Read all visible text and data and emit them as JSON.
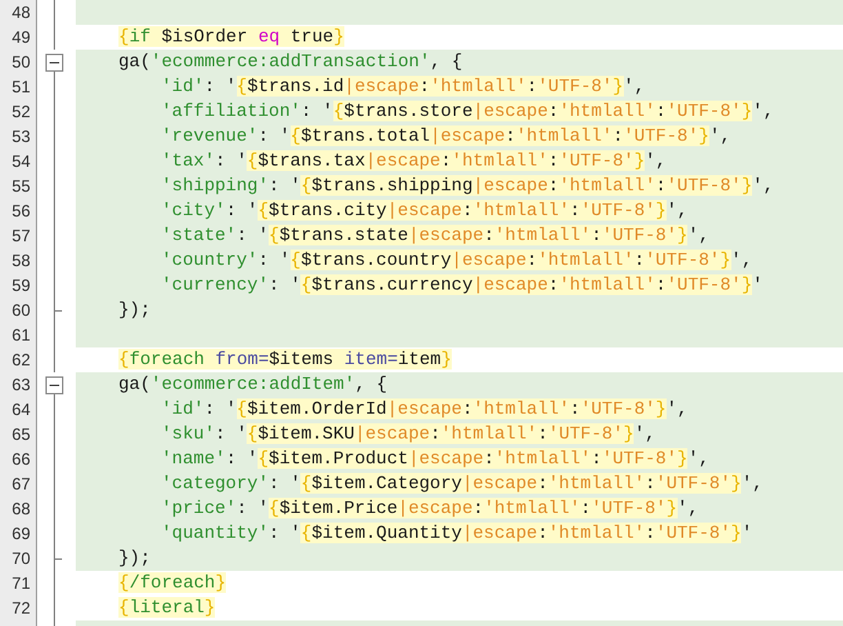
{
  "editor": {
    "lines": [
      {
        "number": "48",
        "kind": "literal"
      },
      {
        "number": "49",
        "kind": "template",
        "tokens": [
          {
            "text": "{",
            "kind": "tag-brace"
          },
          {
            "text": "if",
            "kind": "tag-keyword"
          },
          {
            "text": " $isOrder ",
            "kind": "tag-text"
          },
          {
            "text": "eq",
            "kind": "tag-operator"
          },
          {
            "text": " true",
            "kind": "tag-text"
          },
          {
            "text": "}",
            "kind": "tag-brace"
          }
        ]
      },
      {
        "number": "50",
        "kind": "literal",
        "expanded": true,
        "tokens": [
          {
            "text": "ga(",
            "kind": "code"
          },
          {
            "text": "'ecommerce:addTransaction'",
            "kind": "string"
          },
          {
            "text": ", {",
            "kind": "code"
          }
        ],
        "children": [
          {
            "number": "51",
            "kind": "literal",
            "tokens": [
              {
                "text": "'id'",
                "kind": "string"
              },
              {
                "text": ": '",
                "kind": "code"
              },
              {
                "text": "{",
                "kind": "tag-brace"
              },
              {
                "text": "$trans.id",
                "kind": "tag-text"
              },
              {
                "text": "|escape",
                "kind": "tag-modifier"
              },
              {
                "text": ":",
                "kind": "tag-text"
              },
              {
                "text": "'htmlall'",
                "kind": "tag-modifier"
              },
              {
                "text": ":",
                "kind": "tag-text"
              },
              {
                "text": "'UTF-8'",
                "kind": "tag-modifier"
              },
              {
                "text": "}",
                "kind": "tag-brace"
              },
              {
                "text": "',",
                "kind": "code"
              }
            ]
          },
          {
            "number": "52",
            "kind": "literal",
            "tokens": [
              {
                "text": "'affiliation'",
                "kind": "string"
              },
              {
                "text": ": '",
                "kind": "code"
              },
              {
                "text": "{",
                "kind": "tag-brace"
              },
              {
                "text": "$trans.store",
                "kind": "tag-text"
              },
              {
                "text": "|escape",
                "kind": "tag-modifier"
              },
              {
                "text": ":",
                "kind": "tag-text"
              },
              {
                "text": "'htmlall'",
                "kind": "tag-modifier"
              },
              {
                "text": ":",
                "kind": "tag-text"
              },
              {
                "text": "'UTF-8'",
                "kind": "tag-modifier"
              },
              {
                "text": "}",
                "kind": "tag-brace"
              },
              {
                "text": "',",
                "kind": "code"
              }
            ]
          },
          {
            "number": "53",
            "kind": "literal",
            "tokens": [
              {
                "text": "'revenue'",
                "kind": "string"
              },
              {
                "text": ": '",
                "kind": "code"
              },
              {
                "text": "{",
                "kind": "tag-brace"
              },
              {
                "text": "$trans.total",
                "kind": "tag-text"
              },
              {
                "text": "|escape",
                "kind": "tag-modifier"
              },
              {
                "text": ":",
                "kind": "tag-text"
              },
              {
                "text": "'htmlall'",
                "kind": "tag-modifier"
              },
              {
                "text": ":",
                "kind": "tag-text"
              },
              {
                "text": "'UTF-8'",
                "kind": "tag-modifier"
              },
              {
                "text": "}",
                "kind": "tag-brace"
              },
              {
                "text": "',",
                "kind": "code"
              }
            ]
          },
          {
            "number": "54",
            "kind": "literal",
            "tokens": [
              {
                "text": "'tax'",
                "kind": "string"
              },
              {
                "text": ": '",
                "kind": "code"
              },
              {
                "text": "{",
                "kind": "tag-brace"
              },
              {
                "text": "$trans.tax",
                "kind": "tag-text"
              },
              {
                "text": "|escape",
                "kind": "tag-modifier"
              },
              {
                "text": ":",
                "kind": "tag-text"
              },
              {
                "text": "'htmlall'",
                "kind": "tag-modifier"
              },
              {
                "text": ":",
                "kind": "tag-text"
              },
              {
                "text": "'UTF-8'",
                "kind": "tag-modifier"
              },
              {
                "text": "}",
                "kind": "tag-brace"
              },
              {
                "text": "',",
                "kind": "code"
              }
            ]
          },
          {
            "number": "55",
            "kind": "literal",
            "tokens": [
              {
                "text": "'shipping'",
                "kind": "string"
              },
              {
                "text": ": '",
                "kind": "code"
              },
              {
                "text": "{",
                "kind": "tag-brace"
              },
              {
                "text": "$trans.shipping",
                "kind": "tag-text"
              },
              {
                "text": "|escape",
                "kind": "tag-modifier"
              },
              {
                "text": ":",
                "kind": "tag-text"
              },
              {
                "text": "'htmlall'",
                "kind": "tag-modifier"
              },
              {
                "text": ":",
                "kind": "tag-text"
              },
              {
                "text": "'UTF-8'",
                "kind": "tag-modifier"
              },
              {
                "text": "}",
                "kind": "tag-brace"
              },
              {
                "text": "',",
                "kind": "code"
              }
            ]
          },
          {
            "number": "56",
            "kind": "literal",
            "tokens": [
              {
                "text": "'city'",
                "kind": "string"
              },
              {
                "text": ": '",
                "kind": "code"
              },
              {
                "text": "{",
                "kind": "tag-brace"
              },
              {
                "text": "$trans.city",
                "kind": "tag-text"
              },
              {
                "text": "|escape",
                "kind": "tag-modifier"
              },
              {
                "text": ":",
                "kind": "tag-text"
              },
              {
                "text": "'htmlall'",
                "kind": "tag-modifier"
              },
              {
                "text": ":",
                "kind": "tag-text"
              },
              {
                "text": "'UTF-8'",
                "kind": "tag-modifier"
              },
              {
                "text": "}",
                "kind": "tag-brace"
              },
              {
                "text": "',",
                "kind": "code"
              }
            ]
          },
          {
            "number": "57",
            "kind": "literal",
            "tokens": [
              {
                "text": "'state'",
                "kind": "string"
              },
              {
                "text": ": '",
                "kind": "code"
              },
              {
                "text": "{",
                "kind": "tag-brace"
              },
              {
                "text": "$trans.state",
                "kind": "tag-text"
              },
              {
                "text": "|escape",
                "kind": "tag-modifier"
              },
              {
                "text": ":",
                "kind": "tag-text"
              },
              {
                "text": "'htmlall'",
                "kind": "tag-modifier"
              },
              {
                "text": ":",
                "kind": "tag-text"
              },
              {
                "text": "'UTF-8'",
                "kind": "tag-modifier"
              },
              {
                "text": "}",
                "kind": "tag-brace"
              },
              {
                "text": "',",
                "kind": "code"
              }
            ]
          },
          {
            "number": "58",
            "kind": "literal",
            "tokens": [
              {
                "text": "'country'",
                "kind": "string"
              },
              {
                "text": ": '",
                "kind": "code"
              },
              {
                "text": "{",
                "kind": "tag-brace"
              },
              {
                "text": "$trans.country",
                "kind": "tag-text"
              },
              {
                "text": "|escape",
                "kind": "tag-modifier"
              },
              {
                "text": ":",
                "kind": "tag-text"
              },
              {
                "text": "'htmlall'",
                "kind": "tag-modifier"
              },
              {
                "text": ":",
                "kind": "tag-text"
              },
              {
                "text": "'UTF-8'",
                "kind": "tag-modifier"
              },
              {
                "text": "}",
                "kind": "tag-brace"
              },
              {
                "text": "',",
                "kind": "code"
              }
            ]
          },
          {
            "number": "59",
            "kind": "literal",
            "tokens": [
              {
                "text": "'currency'",
                "kind": "string"
              },
              {
                "text": ": '",
                "kind": "code"
              },
              {
                "text": "{",
                "kind": "tag-brace"
              },
              {
                "text": "$trans.currency",
                "kind": "tag-text"
              },
              {
                "text": "|escape",
                "kind": "tag-modifier"
              },
              {
                "text": ":",
                "kind": "tag-text"
              },
              {
                "text": "'htmlall'",
                "kind": "tag-modifier"
              },
              {
                "text": ":",
                "kind": "tag-text"
              },
              {
                "text": "'UTF-8'",
                "kind": "tag-modifier"
              },
              {
                "text": "}",
                "kind": "tag-brace"
              },
              {
                "text": "'",
                "kind": "code"
              }
            ]
          }
        ]
      },
      {
        "number": "60",
        "kind": "literal",
        "tokens": [
          {
            "text": "});",
            "kind": "code"
          }
        ]
      },
      {
        "number": "61",
        "kind": "literal"
      },
      {
        "number": "62",
        "kind": "template",
        "tokens": [
          {
            "text": "{",
            "kind": "tag-brace"
          },
          {
            "text": "foreach ",
            "kind": "tag-keyword"
          },
          {
            "text": "from=",
            "kind": "tag-attribute"
          },
          {
            "text": "$items ",
            "kind": "tag-text"
          },
          {
            "text": "item=",
            "kind": "tag-attribute"
          },
          {
            "text": "item",
            "kind": "tag-text"
          },
          {
            "text": "}",
            "kind": "tag-brace"
          }
        ]
      },
      {
        "number": "63",
        "kind": "literal",
        "expanded": true,
        "tokens": [
          {
            "text": "ga(",
            "kind": "code"
          },
          {
            "text": "'ecommerce:addItem'",
            "kind": "string"
          },
          {
            "text": ", {",
            "kind": "code"
          }
        ],
        "children": [
          {
            "number": "64",
            "kind": "literal",
            "tokens": [
              {
                "text": "'id'",
                "kind": "string"
              },
              {
                "text": ": '",
                "kind": "code"
              },
              {
                "text": "{",
                "kind": "tag-brace"
              },
              {
                "text": "$item.OrderId",
                "kind": "tag-text"
              },
              {
                "text": "|escape",
                "kind": "tag-modifier"
              },
              {
                "text": ":",
                "kind": "tag-text"
              },
              {
                "text": "'htmlall'",
                "kind": "tag-modifier"
              },
              {
                "text": ":",
                "kind": "tag-text"
              },
              {
                "text": "'UTF-8'",
                "kind": "tag-modifier"
              },
              {
                "text": "}",
                "kind": "tag-brace"
              },
              {
                "text": "',",
                "kind": "code"
              }
            ]
          },
          {
            "number": "65",
            "kind": "literal",
            "tokens": [
              {
                "text": "'sku'",
                "kind": "string"
              },
              {
                "text": ": '",
                "kind": "code"
              },
              {
                "text": "{",
                "kind": "tag-brace"
              },
              {
                "text": "$item.SKU",
                "kind": "tag-text"
              },
              {
                "text": "|escape",
                "kind": "tag-modifier"
              },
              {
                "text": ":",
                "kind": "tag-text"
              },
              {
                "text": "'htmlall'",
                "kind": "tag-modifier"
              },
              {
                "text": ":",
                "kind": "tag-text"
              },
              {
                "text": "'UTF-8'",
                "kind": "tag-modifier"
              },
              {
                "text": "}",
                "kind": "tag-brace"
              },
              {
                "text": "',",
                "kind": "code"
              }
            ]
          },
          {
            "number": "66",
            "kind": "literal",
            "tokens": [
              {
                "text": "'name'",
                "kind": "string"
              },
              {
                "text": ": '",
                "kind": "code"
              },
              {
                "text": "{",
                "kind": "tag-brace"
              },
              {
                "text": "$item.Product",
                "kind": "tag-text"
              },
              {
                "text": "|escape",
                "kind": "tag-modifier"
              },
              {
                "text": ":",
                "kind": "tag-text"
              },
              {
                "text": "'htmlall'",
                "kind": "tag-modifier"
              },
              {
                "text": ":",
                "kind": "tag-text"
              },
              {
                "text": "'UTF-8'",
                "kind": "tag-modifier"
              },
              {
                "text": "}",
                "kind": "tag-brace"
              },
              {
                "text": "',",
                "kind": "code"
              }
            ]
          },
          {
            "number": "67",
            "kind": "literal",
            "tokens": [
              {
                "text": "'category'",
                "kind": "string"
              },
              {
                "text": ": '",
                "kind": "code"
              },
              {
                "text": "{",
                "kind": "tag-brace"
              },
              {
                "text": "$item.Category",
                "kind": "tag-text"
              },
              {
                "text": "|escape",
                "kind": "tag-modifier"
              },
              {
                "text": ":",
                "kind": "tag-text"
              },
              {
                "text": "'htmlall'",
                "kind": "tag-modifier"
              },
              {
                "text": ":",
                "kind": "tag-text"
              },
              {
                "text": "'UTF-8'",
                "kind": "tag-modifier"
              },
              {
                "text": "}",
                "kind": "tag-brace"
              },
              {
                "text": "',",
                "kind": "code"
              }
            ]
          },
          {
            "number": "68",
            "kind": "literal",
            "tokens": [
              {
                "text": "'price'",
                "kind": "string"
              },
              {
                "text": ": '",
                "kind": "code"
              },
              {
                "text": "{",
                "kind": "tag-brace"
              },
              {
                "text": "$item.Price",
                "kind": "tag-text"
              },
              {
                "text": "|escape",
                "kind": "tag-modifier"
              },
              {
                "text": ":",
                "kind": "tag-text"
              },
              {
                "text": "'htmlall'",
                "kind": "tag-modifier"
              },
              {
                "text": ":",
                "kind": "tag-text"
              },
              {
                "text": "'UTF-8'",
                "kind": "tag-modifier"
              },
              {
                "text": "}",
                "kind": "tag-brace"
              },
              {
                "text": "',",
                "kind": "code"
              }
            ]
          },
          {
            "number": "69",
            "kind": "literal",
            "tokens": [
              {
                "text": "'quantity'",
                "kind": "string"
              },
              {
                "text": ": '",
                "kind": "code"
              },
              {
                "text": "{",
                "kind": "tag-brace"
              },
              {
                "text": "$item.Quantity",
                "kind": "tag-text"
              },
              {
                "text": "|escape",
                "kind": "tag-modifier"
              },
              {
                "text": ":",
                "kind": "tag-text"
              },
              {
                "text": "'htmlall'",
                "kind": "tag-modifier"
              },
              {
                "text": ":",
                "kind": "tag-text"
              },
              {
                "text": "'UTF-8'",
                "kind": "tag-modifier"
              },
              {
                "text": "}",
                "kind": "tag-brace"
              },
              {
                "text": "'",
                "kind": "code"
              }
            ]
          }
        ]
      },
      {
        "number": "70",
        "kind": "literal",
        "tokens": [
          {
            "text": "});",
            "kind": "code"
          }
        ]
      },
      {
        "number": "71",
        "kind": "template",
        "tokens": [
          {
            "text": "{",
            "kind": "tag-brace"
          },
          {
            "text": "/foreach",
            "kind": "tag-keyword"
          },
          {
            "text": "}",
            "kind": "tag-brace"
          }
        ]
      },
      {
        "number": "72",
        "kind": "template",
        "tokens": [
          {
            "text": "{",
            "kind": "tag-brace"
          },
          {
            "text": "literal",
            "kind": "tag-keyword"
          },
          {
            "text": "}",
            "kind": "tag-brace"
          }
        ]
      },
      {
        "kind": "literal"
      }
    ]
  }
}
